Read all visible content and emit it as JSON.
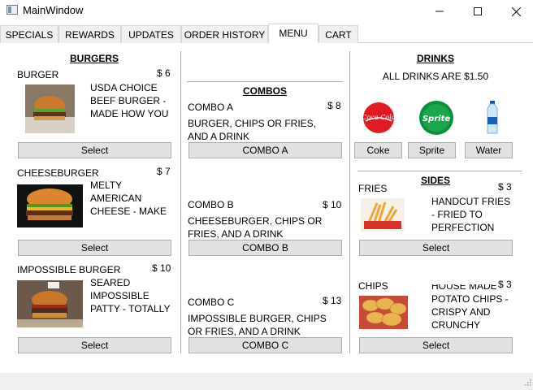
{
  "window": {
    "title": "MainWindow",
    "minimize": "—",
    "maximize": "☐",
    "close": "✕"
  },
  "tabs": [
    "SPECIALS",
    "REWARDS",
    "UPDATES",
    "ORDER HISTORY",
    "MENU",
    "CART"
  ],
  "burgers": {
    "header": "BURGERS",
    "items": [
      {
        "name": "BURGER",
        "price": "$ 6",
        "desc": "USDA CHOICE BEEF BURGER - MADE HOW YOU",
        "button": "Select"
      },
      {
        "name": "CHEESEBURGER",
        "price": "$ 7",
        "desc": "MELTY AMERICAN CHEESE - MAKE IT CHEESY",
        "button": "Select"
      },
      {
        "name": "IMPOSSIBLE BURGER",
        "price": "$ 10",
        "desc": "SEARED IMPOSSIBLE PATTY - TOTALLY VEGAN",
        "button": "Select"
      }
    ]
  },
  "combos": {
    "header": "COMBOS",
    "items": [
      {
        "name": "COMBO A",
        "price": "$ 8",
        "desc": "BURGER, CHIPS OR FRIES, AND A DRINK",
        "button": "COMBO A"
      },
      {
        "name": "COMBO B",
        "price": "$ 10",
        "desc": "CHEESEBURGER, CHIPS OR FRIES, AND A DRINK",
        "button": "COMBO B"
      },
      {
        "name": "COMBO C",
        "price": "$ 13",
        "desc": "IMPOSSIBLE BURGER, CHIPS OR FRIES, AND A DRINK",
        "button": "COMBO C"
      }
    ]
  },
  "drinks": {
    "header": "DRINKS",
    "note": "ALL DRINKS ARE $1.50",
    "items": [
      {
        "button": "Coke",
        "logo_text": "Coca-Cola"
      },
      {
        "button": "Sprite",
        "logo_text": "Sprite"
      },
      {
        "button": "Water"
      }
    ]
  },
  "sides": {
    "header": "SIDES",
    "items": [
      {
        "name": "FRIES",
        "price": "$ 3",
        "desc": "HANDCUT FRIES - FRIED TO PERFECTION",
        "button": "Select"
      },
      {
        "name": "CHIPS",
        "price": "$ 3",
        "desc": "HOUSE MADE POTATO CHIPS - CRISPY AND CRUNCHY",
        "button": "Select"
      }
    ]
  },
  "colors": {
    "coke_red": "#e21b23",
    "sprite_green": "#0a8f3c",
    "button_face": "#e1e1e1"
  },
  "icons": {
    "grip": "size-grip-icon"
  }
}
